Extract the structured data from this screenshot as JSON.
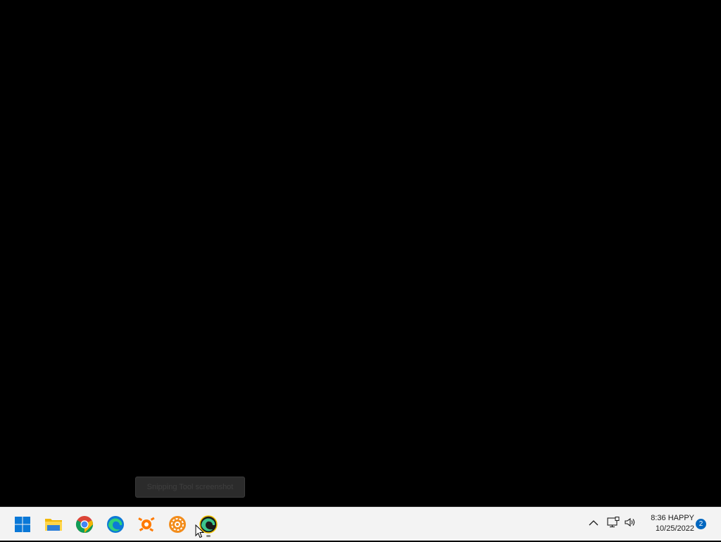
{
  "desktop": {
    "tooltip_text": "Snipping Tool screenshot"
  },
  "taskbar": {
    "apps": [
      {
        "name": "start",
        "icon": "windows-logo-icon"
      },
      {
        "name": "file-explorer",
        "icon": "folder-icon"
      },
      {
        "name": "chrome",
        "icon": "chrome-icon"
      },
      {
        "name": "edge",
        "icon": "edge-icon"
      },
      {
        "name": "avast",
        "icon": "avast-icon"
      },
      {
        "name": "settings-app",
        "icon": "orange-gear-icon"
      },
      {
        "name": "edge-canary",
        "icon": "edge-canary-icon"
      }
    ],
    "tray": {
      "chevron_icon": "chevron-up-icon",
      "network_icon": "network-icon",
      "volume_icon": "volume-icon",
      "time": "8:36 HAPPY",
      "date": "10/25/2022",
      "notification_count": "2"
    }
  },
  "colors": {
    "taskbar_bg": "#f3f3f3",
    "desktop_bg": "#000000",
    "accent": "#0067c0"
  }
}
